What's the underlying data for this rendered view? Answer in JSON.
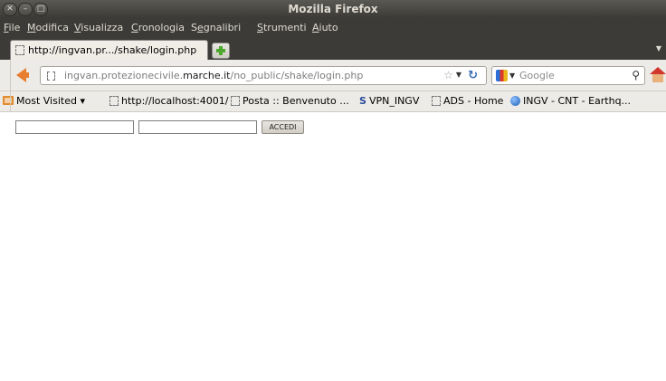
{
  "window": {
    "title": "Mozilla Firefox",
    "controls": [
      "close",
      "minimize",
      "maximize"
    ]
  },
  "menubar": {
    "items": [
      {
        "label": "File",
        "accel": "F"
      },
      {
        "label": "Modifica",
        "accel": "M"
      },
      {
        "label": "Visualizza",
        "accel": "V"
      },
      {
        "label": "Cronologia",
        "accel": "C"
      },
      {
        "label": "Segnalibri",
        "accel": "e"
      },
      {
        "label": "Strumenti",
        "accel": "S"
      },
      {
        "label": "Aiuto",
        "accel": "A"
      }
    ]
  },
  "tabs": {
    "active_label": "http://ingvan.pr.../shake/login.php"
  },
  "navbar": {
    "url_prefix": "ingvan.protezionecivile.",
    "url_domain": "marche.it",
    "url_path": "/no_public/shake/login.php",
    "search_placeholder": "Google"
  },
  "bookmarks": [
    {
      "label": "Most Visited ▾",
      "icon": "folder-icon"
    },
    {
      "label": "http://localhost:4001/",
      "icon": "page-icon"
    },
    {
      "label": "Posta :: Benvenuto ...",
      "icon": "page-icon"
    },
    {
      "label": "VPN_INGV",
      "icon": "vpn-icon"
    },
    {
      "label": "ADS - Home",
      "icon": "page-icon"
    },
    {
      "label": "INGV - CNT - Earthq...",
      "icon": "globe-icon"
    }
  ],
  "page": {
    "username_value": "",
    "password_value": "",
    "submit_label": "ACCEDI"
  }
}
